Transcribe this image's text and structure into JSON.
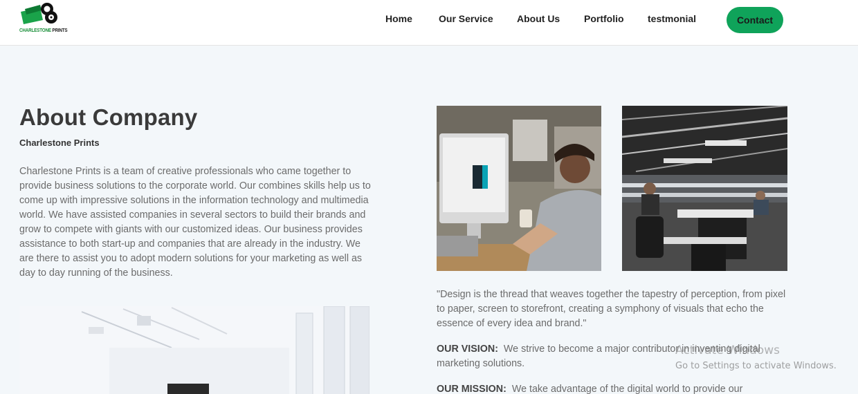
{
  "header": {
    "logo_text_a": "CHARLESTONE",
    "logo_text_b": "PRINTS",
    "nav": [
      {
        "label": "Home"
      },
      {
        "label": "Our Service"
      },
      {
        "label": "About Us"
      },
      {
        "label": "Portfolio"
      },
      {
        "label": "testmonial"
      }
    ],
    "contact_label": "Contact",
    "brand_color": "#0fa35a"
  },
  "about": {
    "title": "About Company",
    "subtitle": "Charlestone Prints",
    "body": "Charlestone Prints is a team of creative professionals who came together to provide business solutions to the corporate world. Our combines skills help us to come up with impressive solutions in the information technology and multimedia world. We have assisted companies in several sectors to build their brands and grow to compete with giants with our customized ideas. Our business provides assistance to both start-up and companies that are already in the industry. We are there to assist you to adopt modern solutions for your marketing as well as day to day running of the business."
  },
  "right": {
    "quote": "\"Design is the thread that weaves together the tapestry of perception, from pixel to paper, screen to storefront, creating a symphony of visuals that echo the essence of every idea and brand.\"",
    "vision_label": "OUR VISION:",
    "vision_text": "We strive to become a major contributor in inventing digital marketing solutions.",
    "mission_label": "OUR MISSION:",
    "mission_text": "We take advantage of the digital world to provide our"
  },
  "watermark": {
    "title": "Activate Windows",
    "subtitle": "Go to Settings to activate Windows."
  }
}
